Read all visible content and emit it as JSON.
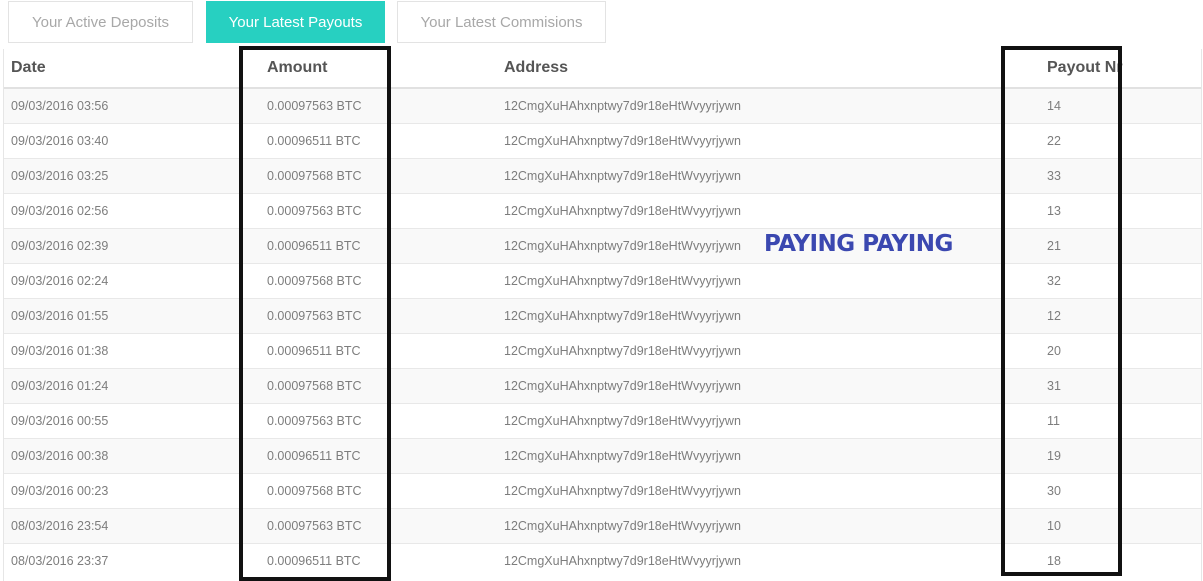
{
  "tabs": [
    {
      "label": "Your Active Deposits",
      "active": false
    },
    {
      "label": "Your Latest Payouts",
      "active": true
    },
    {
      "label": "Your Latest Commisions",
      "active": false
    }
  ],
  "table": {
    "headers": {
      "date": "Date",
      "amount": "Amount",
      "address": "Address",
      "payout_nr": "Payout Nr"
    },
    "rows": [
      {
        "date": "09/03/2016 03:56",
        "amount": "0.00097563 BTC",
        "address": "12CmgXuHAhxnptwy7d9r18eHtWvyyrjywn",
        "payout_nr": "14"
      },
      {
        "date": "09/03/2016 03:40",
        "amount": "0.00096511 BTC",
        "address": "12CmgXuHAhxnptwy7d9r18eHtWvyyrjywn",
        "payout_nr": "22"
      },
      {
        "date": "09/03/2016 03:25",
        "amount": "0.00097568 BTC",
        "address": "12CmgXuHAhxnptwy7d9r18eHtWvyyrjywn",
        "payout_nr": "33"
      },
      {
        "date": "09/03/2016 02:56",
        "amount": "0.00097563 BTC",
        "address": "12CmgXuHAhxnptwy7d9r18eHtWvyyrjywn",
        "payout_nr": "13"
      },
      {
        "date": "09/03/2016 02:39",
        "amount": "0.00096511 BTC",
        "address": "12CmgXuHAhxnptwy7d9r18eHtWvyyrjywn",
        "payout_nr": "21"
      },
      {
        "date": "09/03/2016 02:24",
        "amount": "0.00097568 BTC",
        "address": "12CmgXuHAhxnptwy7d9r18eHtWvyyrjywn",
        "payout_nr": "32"
      },
      {
        "date": "09/03/2016 01:55",
        "amount": "0.00097563 BTC",
        "address": "12CmgXuHAhxnptwy7d9r18eHtWvyyrjywn",
        "payout_nr": "12"
      },
      {
        "date": "09/03/2016 01:38",
        "amount": "0.00096511 BTC",
        "address": "12CmgXuHAhxnptwy7d9r18eHtWvyyrjywn",
        "payout_nr": "20"
      },
      {
        "date": "09/03/2016 01:24",
        "amount": "0.00097568 BTC",
        "address": "12CmgXuHAhxnptwy7d9r18eHtWvyyrjywn",
        "payout_nr": "31"
      },
      {
        "date": "09/03/2016 00:55",
        "amount": "0.00097563 BTC",
        "address": "12CmgXuHAhxnptwy7d9r18eHtWvyyrjywn",
        "payout_nr": "11"
      },
      {
        "date": "09/03/2016 00:38",
        "amount": "0.00096511 BTC",
        "address": "12CmgXuHAhxnptwy7d9r18eHtWvyyrjywn",
        "payout_nr": "19"
      },
      {
        "date": "09/03/2016 00:23",
        "amount": "0.00097568 BTC",
        "address": "12CmgXuHAhxnptwy7d9r18eHtWvyyrjywn",
        "payout_nr": "30"
      },
      {
        "date": "08/03/2016 23:54",
        "amount": "0.00097563 BTC",
        "address": "12CmgXuHAhxnptwy7d9r18eHtWvyyrjywn",
        "payout_nr": "10"
      },
      {
        "date": "08/03/2016 23:37",
        "amount": "0.00096511 BTC",
        "address": "12CmgXuHAhxnptwy7d9r18eHtWvyyrjywn",
        "payout_nr": "18"
      }
    ]
  },
  "annotation": {
    "text": "PAYING PAYING",
    "color": "#3b48b0"
  },
  "colors": {
    "accent": "#27d0c1",
    "highlight_box": "#111111"
  }
}
